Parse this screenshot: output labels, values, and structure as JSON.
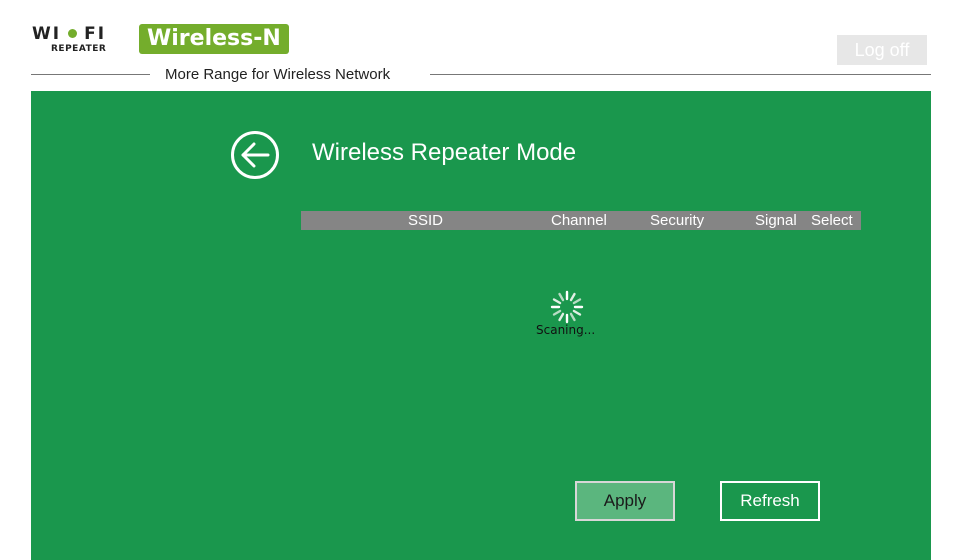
{
  "header": {
    "logo_wifi_text": "WI",
    "logo_wifi_text2": "FI",
    "logo_sub": "REPEATER",
    "logo_badge": "Wireless-N",
    "tagline": "More Range for Wireless Network",
    "logoff_label": "Log off"
  },
  "panel": {
    "title": "Wireless Repeater Mode",
    "back_icon": "arrow-left-circle-icon"
  },
  "table": {
    "columns": [
      "SSID",
      "Channel",
      "Security",
      "Signal",
      "Select"
    ]
  },
  "status": {
    "scan_text": "Scaning..."
  },
  "buttons": {
    "apply_label": "Apply",
    "refresh_label": "Refresh"
  },
  "colors": {
    "panel_green": "#1a974d",
    "logo_green": "#74ad2c",
    "header_gray": "#858585",
    "apply_bg": "#5bb67e"
  }
}
